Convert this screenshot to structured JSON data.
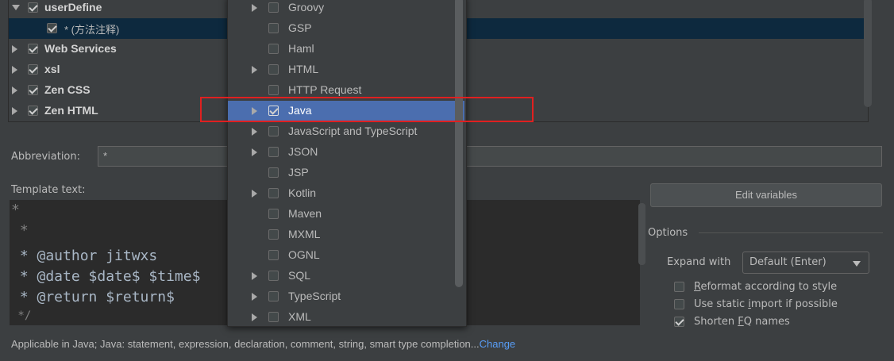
{
  "tree": {
    "items": [
      {
        "label": "userDefine",
        "checked": true,
        "expanded": true
      },
      {
        "label": "* (方法注释)",
        "checked": true,
        "selected": true
      },
      {
        "label": "Web Services",
        "checked": true
      },
      {
        "label": "xsl",
        "checked": true
      },
      {
        "label": "Zen CSS",
        "checked": true
      },
      {
        "label": "Zen HTML",
        "checked": true
      }
    ]
  },
  "abbreviation": {
    "label": "Abbreviation:",
    "value": "*"
  },
  "template": {
    "label": "Template text:",
    "lines": [
      "*",
      " *",
      " * @author jitwxs",
      " * @date $date$ $time$",
      " * @return $return$",
      " */"
    ]
  },
  "applicable": {
    "text": "Applicable in Java; Java: statement, expression, declaration, comment, string, smart type completion...",
    "change_label": "Change"
  },
  "edit_variables_label": "Edit variables",
  "options": {
    "title": "Options",
    "expand_with_label": "Expand with",
    "expand_with_value": "Default (Enter)",
    "reformat": {
      "label_pre": "",
      "mnemonic": "R",
      "label_post": "eformat according to style",
      "checked": false
    },
    "static_import": {
      "label_pre": "Use static ",
      "mnemonic": "i",
      "label_post": "mport if possible",
      "checked": false
    },
    "shorten_fq": {
      "label_pre": "Shorten ",
      "mnemonic": "F",
      "label_post": "Q names",
      "checked": true
    }
  },
  "popup": {
    "items": [
      {
        "label": "Groovy",
        "expandable": true,
        "checked": false
      },
      {
        "label": "GSP",
        "expandable": false,
        "checked": false
      },
      {
        "label": "Haml",
        "expandable": false,
        "checked": false
      },
      {
        "label": "HTML",
        "expandable": true,
        "checked": false
      },
      {
        "label": "HTTP Request",
        "expandable": false,
        "checked": false
      },
      {
        "label": "Java",
        "expandable": true,
        "checked": true,
        "selected": true
      },
      {
        "label": "JavaScript and TypeScript",
        "expandable": true,
        "checked": false
      },
      {
        "label": "JSON",
        "expandable": true,
        "checked": false
      },
      {
        "label": "JSP",
        "expandable": false,
        "checked": false
      },
      {
        "label": "Kotlin",
        "expandable": true,
        "checked": false
      },
      {
        "label": "Maven",
        "expandable": false,
        "checked": false
      },
      {
        "label": "MXML",
        "expandable": false,
        "checked": false
      },
      {
        "label": "OGNL",
        "expandable": false,
        "checked": false
      },
      {
        "label": "SQL",
        "expandable": true,
        "checked": false
      },
      {
        "label": "TypeScript",
        "expandable": true,
        "checked": false
      },
      {
        "label": "XML",
        "expandable": true,
        "checked": false
      }
    ]
  },
  "colors": {
    "background": "#3c3f41",
    "selection": "#4b6eaf",
    "highlight_border": "#e02020",
    "link": "#589df6"
  }
}
